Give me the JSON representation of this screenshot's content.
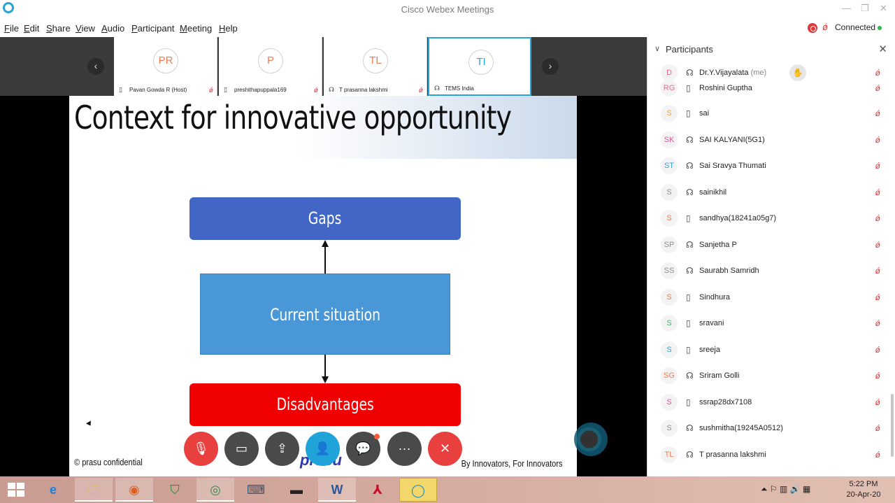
{
  "window": {
    "title": "Cisco Webex Meetings",
    "minimize": "—",
    "maximize": "❐",
    "close": "✕"
  },
  "menu": {
    "items": [
      {
        "label": "File",
        "key": "F",
        "rest": "ile"
      },
      {
        "label": "Edit",
        "key": "E",
        "rest": "dit"
      },
      {
        "label": "Share",
        "key": "S",
        "rest": "hare"
      },
      {
        "label": "View",
        "key": "V",
        "rest": "iew"
      },
      {
        "label": "Audio",
        "key": "A",
        "rest": "udio"
      },
      {
        "label": "Participant",
        "key": "P",
        "rest": "articipant"
      },
      {
        "label": "Meeting",
        "key": "M",
        "rest": "eeting"
      },
      {
        "label": "Help",
        "key": "H",
        "rest": "elp"
      }
    ],
    "status": "Connected"
  },
  "video_strip": {
    "prev": "‹",
    "next": "›",
    "thumbs": [
      {
        "initials": "PR",
        "name": "Pavan Gowda R (Host)",
        "device": "▯"
      },
      {
        "initials": "P",
        "name": "preshithapuppala169",
        "device": "▯"
      },
      {
        "initials": "TL",
        "name": "T prasanna lakshmi",
        "device": "☊"
      },
      {
        "initials": "TI",
        "name": "TEMS India",
        "device": "☊"
      }
    ]
  },
  "slide": {
    "title": "Context for innovative opportunity",
    "box_top": "Gaps",
    "box_middle": "Current situation",
    "box_bottom": "Disadvantages",
    "footer_left": "© prasu confidential",
    "footer_right": "By Innovators, For Innovators",
    "footer_logo": "prasu"
  },
  "controls": {
    "mute": "🎙",
    "video": "▭",
    "share": "⇪",
    "participants": "👤",
    "chat": "💬",
    "more": "···",
    "leave": "✕"
  },
  "participants_panel": {
    "title": "Participants",
    "chevron": "∨",
    "close": "✕",
    "hand": "✋",
    "mute_glyph": "ǿ",
    "people": [
      {
        "initials": "D",
        "name": "Dr.Y.Vijayalata",
        "suffix": "(me)",
        "device": "☊",
        "color": "#e46d8d"
      },
      {
        "initials": "RG",
        "name": "Roshini Guptha",
        "suffix": "",
        "device": "▯",
        "color": "#e46d8d"
      },
      {
        "initials": "S",
        "name": "sai",
        "suffix": "",
        "device": "▯",
        "color": "#f2a33a"
      },
      {
        "initials": "SK",
        "name": "SAI KALYANI(5G1)",
        "suffix": "",
        "device": "☊",
        "color": "#d9589a"
      },
      {
        "initials": "ST",
        "name": "Sai Sravya Thumati",
        "suffix": "",
        "device": "☊",
        "color": "#2aa3d6"
      },
      {
        "initials": "S",
        "name": "sainikhil",
        "suffix": "",
        "device": "☊",
        "color": "#8e8e8e"
      },
      {
        "initials": "S",
        "name": "sandhya(18241a05g7)",
        "suffix": "",
        "device": "▯",
        "color": "#f07b53"
      },
      {
        "initials": "SP",
        "name": "Sanjetha P",
        "suffix": "",
        "device": "☊",
        "color": "#8e8e8e"
      },
      {
        "initials": "SS",
        "name": "Saurabh Samridh",
        "suffix": "",
        "device": "☊",
        "color": "#8e8e8e"
      },
      {
        "initials": "S",
        "name": "Sindhura",
        "suffix": "",
        "device": "▯",
        "color": "#f07b53"
      },
      {
        "initials": "S",
        "name": "sravani",
        "suffix": "",
        "device": "▯",
        "color": "#3cb56b"
      },
      {
        "initials": "S",
        "name": "sreeja",
        "suffix": "",
        "device": "▯",
        "color": "#2aa3d6"
      },
      {
        "initials": "SG",
        "name": "Sriram Golli",
        "suffix": "",
        "device": "☊",
        "color": "#f07b53"
      },
      {
        "initials": "S",
        "name": "ssrap28dx7108",
        "suffix": "",
        "device": "▯",
        "color": "#d9589a"
      },
      {
        "initials": "S",
        "name": "sushmitha(19245A0512)",
        "suffix": "",
        "device": "☊",
        "color": "#8e8e8e"
      },
      {
        "initials": "TL",
        "name": "T prasanna lakshmi",
        "suffix": "",
        "device": "☊",
        "color": "#f07b53"
      }
    ]
  },
  "taskbar": {
    "apps": [
      "e",
      "🗀",
      "◉",
      "⛉",
      "◎",
      "⌨",
      "▬",
      "W",
      "⅄",
      "◯"
    ],
    "tray": "⏶  ⚐  ▥  🔊  ▦",
    "time": "5:22 PM",
    "date": "20-Apr-20"
  },
  "colors": {
    "accent": "#2aa3d6",
    "muted_red": "#e0363c",
    "gaps_box": "#4266c6",
    "current_box": "#4a97d8",
    "disadvantages_box": "#f00000"
  }
}
